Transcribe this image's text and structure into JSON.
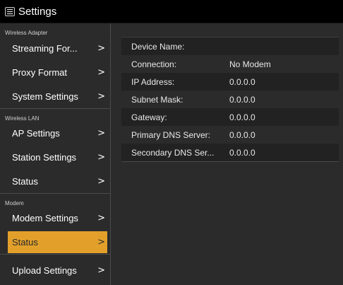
{
  "header": {
    "title": "Settings"
  },
  "sidebar": {
    "sections": [
      {
        "title": "Wireless Adapter",
        "items": [
          {
            "label": "Streaming For...",
            "chevron": ">"
          },
          {
            "label": "Proxy Format",
            "chevron": ">"
          },
          {
            "label": "System Settings",
            "chevron": ">"
          }
        ]
      },
      {
        "title": "Wireless LAN",
        "items": [
          {
            "label": "AP Settings",
            "chevron": ">"
          },
          {
            "label": "Station Settings",
            "chevron": ">"
          },
          {
            "label": "Status",
            "chevron": ">"
          }
        ]
      },
      {
        "title": "Modem",
        "items": [
          {
            "label": "Modem Settings",
            "chevron": ">"
          },
          {
            "label": "Status",
            "chevron": ">",
            "selected": true
          }
        ]
      }
    ],
    "footer_item": {
      "label": "Upload Settings",
      "chevron": ">"
    }
  },
  "main": {
    "rows": [
      {
        "label": "Device Name:",
        "value": ""
      },
      {
        "label": "Connection:",
        "value": "No Modem"
      },
      {
        "label": "IP Address:",
        "value": "0.0.0.0"
      },
      {
        "label": "Subnet Mask:",
        "value": "0.0.0.0"
      },
      {
        "label": "Gateway:",
        "value": "0.0.0.0"
      },
      {
        "label": "Primary DNS Server:",
        "value": "0.0.0.0"
      },
      {
        "label": "Secondary DNS Ser...",
        "value": "0.0.0.0"
      }
    ]
  },
  "colors": {
    "accent": "#e2a02b",
    "background": "#2b2b2b",
    "header": "#000000"
  },
  "icons": {
    "menu": "hamburger-menu-icon",
    "chevron": "chevron-right-icon"
  }
}
